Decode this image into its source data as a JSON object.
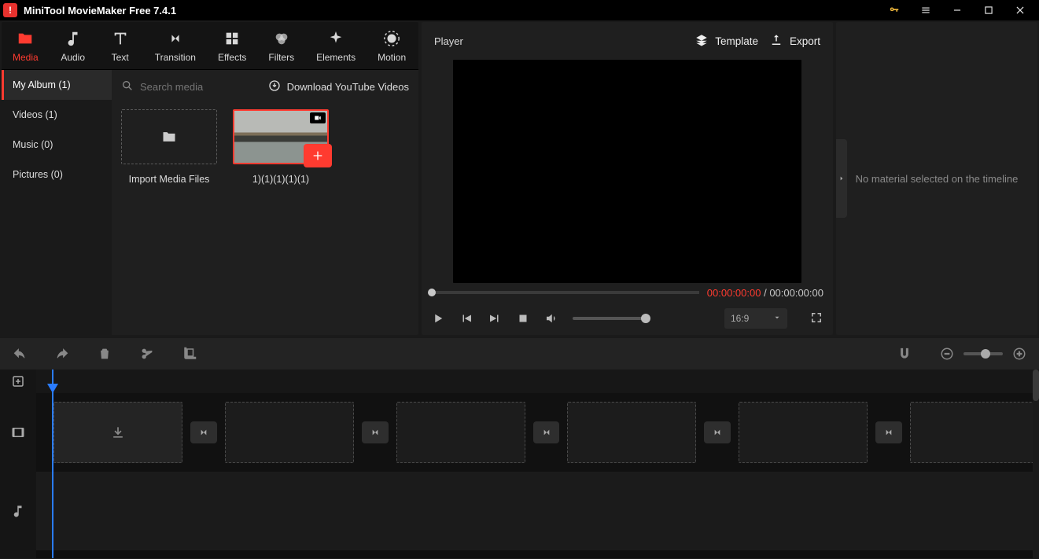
{
  "app": {
    "title": "MiniTool MovieMaker Free 7.4.1"
  },
  "tabs": {
    "media": "Media",
    "audio": "Audio",
    "text": "Text",
    "transition": "Transition",
    "effects": "Effects",
    "filters": "Filters",
    "elements": "Elements",
    "motion": "Motion"
  },
  "folders": {
    "album": "My Album (1)",
    "videos": "Videos (1)",
    "music": "Music (0)",
    "pictures": "Pictures (0)"
  },
  "mediaBar": {
    "search_placeholder": "Search media",
    "download_label": "Download YouTube Videos"
  },
  "mediaCards": {
    "import_label": "Import Media Files",
    "clip1_label": "1)(1)(1)(1)(1)"
  },
  "player": {
    "title": "Player",
    "template_label": "Template",
    "export_label": "Export",
    "time_current": "00:00:00:00",
    "time_sep": " / ",
    "time_total": "00:00:00:00",
    "aspect": "16:9"
  },
  "inspector": {
    "empty": "No material selected on the timeline"
  }
}
